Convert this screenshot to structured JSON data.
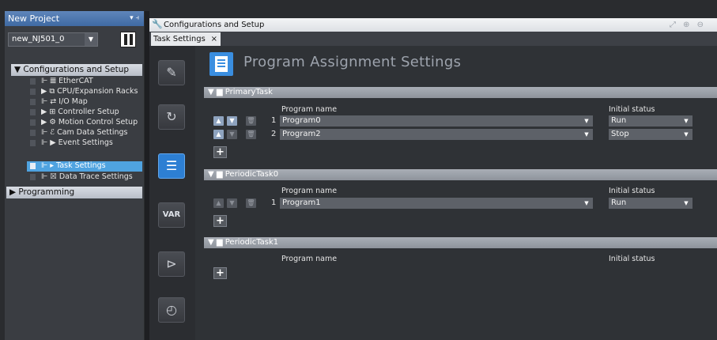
{
  "project_panel": {
    "title": "New Project",
    "pin": "▾ ⫞",
    "device": "new_NJ501_0",
    "sections": [
      {
        "label": "▼ Configurations and Setup"
      },
      {
        "label": "▶ Programming"
      }
    ],
    "tree": [
      {
        "label": "⊩ 𝍤 EtherCAT"
      },
      {
        "label": "▶ ⧉ CPU/Expansion Racks"
      },
      {
        "label": "⊩ ⇄ I/O Map"
      },
      {
        "label": "▶ ⊞ Controller Setup"
      },
      {
        "label": "▶ ⚙ Motion Control Setup"
      },
      {
        "label": "⊩ ℰ Cam Data Settings"
      },
      {
        "label": "⊩ ▶ Event Settings"
      },
      {
        "label": "⊩ ▸ Task Settings"
      },
      {
        "label": "⊩ ☒ Data Trace Settings"
      }
    ]
  },
  "main": {
    "window_title": "Configurations and Setup",
    "window_tools": "⤢ ⊕ ⊖",
    "tab": {
      "label": "Task Settings",
      "close": "×"
    },
    "page_title": "Program Assignment Settings",
    "side_buttons": {
      "var": "VAR"
    },
    "col_program": "Program name",
    "col_status": "Initial status",
    "tasks": [
      {
        "name": "▼ ▆ PrimaryTask",
        "rows": [
          {
            "num": "1",
            "program": "Program0",
            "status": "Run"
          },
          {
            "num": "2",
            "program": "Program2",
            "status": "Stop"
          }
        ]
      },
      {
        "name": "▼ ▆ PeriodicTask0",
        "rows": [
          {
            "num": "1",
            "program": "Program1",
            "status": "Run"
          }
        ]
      },
      {
        "name": "▼ ▆ PeriodicTask1",
        "rows": []
      }
    ]
  }
}
